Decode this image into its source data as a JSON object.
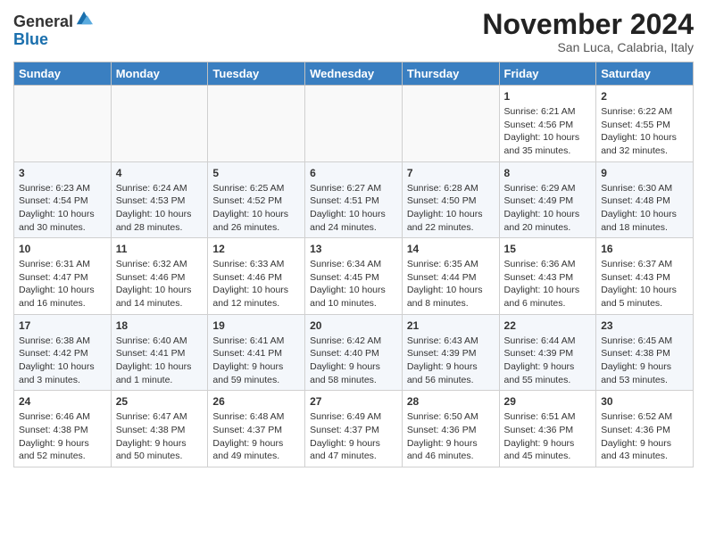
{
  "header": {
    "logo_general": "General",
    "logo_blue": "Blue",
    "month_title": "November 2024",
    "subtitle": "San Luca, Calabria, Italy"
  },
  "days_of_week": [
    "Sunday",
    "Monday",
    "Tuesday",
    "Wednesday",
    "Thursday",
    "Friday",
    "Saturday"
  ],
  "weeks": [
    [
      {
        "day": "",
        "info": ""
      },
      {
        "day": "",
        "info": ""
      },
      {
        "day": "",
        "info": ""
      },
      {
        "day": "",
        "info": ""
      },
      {
        "day": "",
        "info": ""
      },
      {
        "day": "1",
        "info": "Sunrise: 6:21 AM\nSunset: 4:56 PM\nDaylight: 10 hours and 35 minutes."
      },
      {
        "day": "2",
        "info": "Sunrise: 6:22 AM\nSunset: 4:55 PM\nDaylight: 10 hours and 32 minutes."
      }
    ],
    [
      {
        "day": "3",
        "info": "Sunrise: 6:23 AM\nSunset: 4:54 PM\nDaylight: 10 hours and 30 minutes."
      },
      {
        "day": "4",
        "info": "Sunrise: 6:24 AM\nSunset: 4:53 PM\nDaylight: 10 hours and 28 minutes."
      },
      {
        "day": "5",
        "info": "Sunrise: 6:25 AM\nSunset: 4:52 PM\nDaylight: 10 hours and 26 minutes."
      },
      {
        "day": "6",
        "info": "Sunrise: 6:27 AM\nSunset: 4:51 PM\nDaylight: 10 hours and 24 minutes."
      },
      {
        "day": "7",
        "info": "Sunrise: 6:28 AM\nSunset: 4:50 PM\nDaylight: 10 hours and 22 minutes."
      },
      {
        "day": "8",
        "info": "Sunrise: 6:29 AM\nSunset: 4:49 PM\nDaylight: 10 hours and 20 minutes."
      },
      {
        "day": "9",
        "info": "Sunrise: 6:30 AM\nSunset: 4:48 PM\nDaylight: 10 hours and 18 minutes."
      }
    ],
    [
      {
        "day": "10",
        "info": "Sunrise: 6:31 AM\nSunset: 4:47 PM\nDaylight: 10 hours and 16 minutes."
      },
      {
        "day": "11",
        "info": "Sunrise: 6:32 AM\nSunset: 4:46 PM\nDaylight: 10 hours and 14 minutes."
      },
      {
        "day": "12",
        "info": "Sunrise: 6:33 AM\nSunset: 4:46 PM\nDaylight: 10 hours and 12 minutes."
      },
      {
        "day": "13",
        "info": "Sunrise: 6:34 AM\nSunset: 4:45 PM\nDaylight: 10 hours and 10 minutes."
      },
      {
        "day": "14",
        "info": "Sunrise: 6:35 AM\nSunset: 4:44 PM\nDaylight: 10 hours and 8 minutes."
      },
      {
        "day": "15",
        "info": "Sunrise: 6:36 AM\nSunset: 4:43 PM\nDaylight: 10 hours and 6 minutes."
      },
      {
        "day": "16",
        "info": "Sunrise: 6:37 AM\nSunset: 4:43 PM\nDaylight: 10 hours and 5 minutes."
      }
    ],
    [
      {
        "day": "17",
        "info": "Sunrise: 6:38 AM\nSunset: 4:42 PM\nDaylight: 10 hours and 3 minutes."
      },
      {
        "day": "18",
        "info": "Sunrise: 6:40 AM\nSunset: 4:41 PM\nDaylight: 10 hours and 1 minute."
      },
      {
        "day": "19",
        "info": "Sunrise: 6:41 AM\nSunset: 4:41 PM\nDaylight: 9 hours and 59 minutes."
      },
      {
        "day": "20",
        "info": "Sunrise: 6:42 AM\nSunset: 4:40 PM\nDaylight: 9 hours and 58 minutes."
      },
      {
        "day": "21",
        "info": "Sunrise: 6:43 AM\nSunset: 4:39 PM\nDaylight: 9 hours and 56 minutes."
      },
      {
        "day": "22",
        "info": "Sunrise: 6:44 AM\nSunset: 4:39 PM\nDaylight: 9 hours and 55 minutes."
      },
      {
        "day": "23",
        "info": "Sunrise: 6:45 AM\nSunset: 4:38 PM\nDaylight: 9 hours and 53 minutes."
      }
    ],
    [
      {
        "day": "24",
        "info": "Sunrise: 6:46 AM\nSunset: 4:38 PM\nDaylight: 9 hours and 52 minutes."
      },
      {
        "day": "25",
        "info": "Sunrise: 6:47 AM\nSunset: 4:38 PM\nDaylight: 9 hours and 50 minutes."
      },
      {
        "day": "26",
        "info": "Sunrise: 6:48 AM\nSunset: 4:37 PM\nDaylight: 9 hours and 49 minutes."
      },
      {
        "day": "27",
        "info": "Sunrise: 6:49 AM\nSunset: 4:37 PM\nDaylight: 9 hours and 47 minutes."
      },
      {
        "day": "28",
        "info": "Sunrise: 6:50 AM\nSunset: 4:36 PM\nDaylight: 9 hours and 46 minutes."
      },
      {
        "day": "29",
        "info": "Sunrise: 6:51 AM\nSunset: 4:36 PM\nDaylight: 9 hours and 45 minutes."
      },
      {
        "day": "30",
        "info": "Sunrise: 6:52 AM\nSunset: 4:36 PM\nDaylight: 9 hours and 43 minutes."
      }
    ]
  ]
}
